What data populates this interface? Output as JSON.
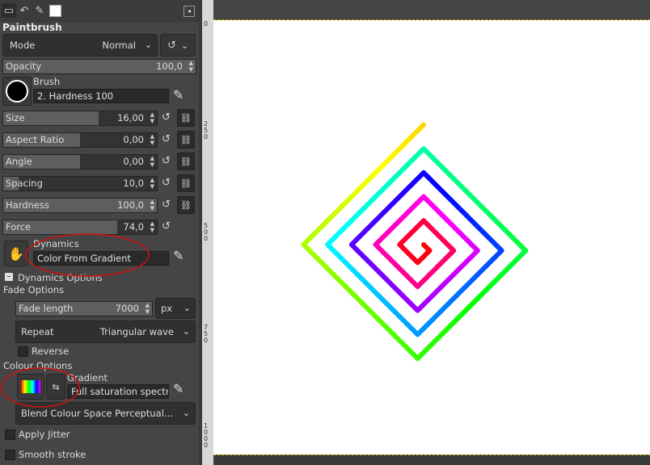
{
  "panel": {
    "tabs": [
      "tool-options",
      "undo-history",
      "paths",
      "images"
    ],
    "tool_title": "Paintbrush",
    "mode": {
      "label": "Mode",
      "value": "Normal"
    },
    "opacity": {
      "label": "Opacity",
      "value": "100,0",
      "fraction": 1.0
    },
    "brush": {
      "label": "Brush",
      "name": "2. Hardness 100"
    },
    "sliders": [
      {
        "label": "Size",
        "value": "16,00",
        "fraction": 0.62
      },
      {
        "label": "Aspect Ratio",
        "value": "0,00",
        "fraction": 0.5
      },
      {
        "label": "Angle",
        "value": "0,00",
        "fraction": 0.5
      },
      {
        "label": "Spacing",
        "value": "10,0",
        "fraction": 0.1
      },
      {
        "label": "Hardness",
        "value": "100,0",
        "fraction": 1.0
      }
    ],
    "force": {
      "label": "Force",
      "value": "74,0",
      "fraction": 0.74
    },
    "dynamics": {
      "label": "Dynamics",
      "name": "Color From Gradient"
    },
    "dynamics_options": "Dynamics Options",
    "fade_options": "Fade Options",
    "fade_length": {
      "label": "Fade length",
      "value": "7000",
      "unit": "px"
    },
    "repeat": {
      "label": "Repeat",
      "value": "Triangular wave"
    },
    "reverse": "Reverse",
    "colour_options": "Colour Options",
    "gradient": {
      "label": "Gradient",
      "name": "Full saturation spectrum CCW"
    },
    "blend": "Blend Colour Space Perceptual RGB",
    "apply_jitter": "Apply Jitter",
    "smooth_stroke": "Smooth stroke"
  },
  "ruler": {
    "marks": [
      "0",
      "2\n5\n0",
      "5\n0\n0",
      "7\n5\n0",
      "1\n0\n0\n0"
    ]
  },
  "canvas": {
    "colors": {
      "selected_tab": "#2d2d2d",
      "annotation": "#d01010",
      "panel_bg": "#454545",
      "canvas_bg": "#ffffff"
    }
  }
}
